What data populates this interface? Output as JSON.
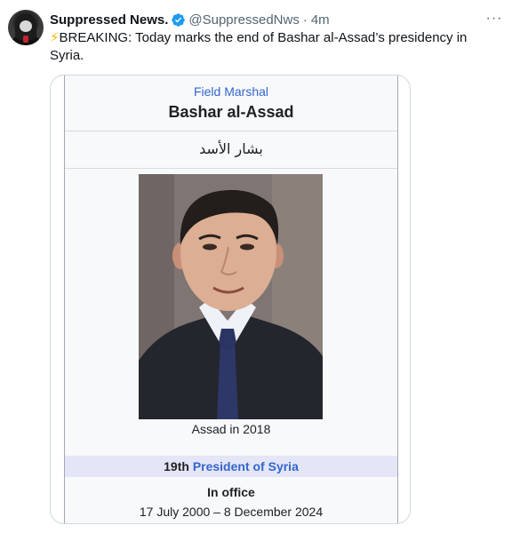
{
  "tweet": {
    "display_name": "Suppressed News.",
    "verified_icon": "verified-badge-icon",
    "handle": "@SuppressedNws",
    "separator": "·",
    "time": "4m",
    "more_icon": "more-options-icon",
    "more_glyph": "···",
    "bolt": "⚡",
    "text": "BREAKING: Today marks the end of Bashar al-Assad’s presidency in Syria."
  },
  "infobox": {
    "rank": "Field Marshal",
    "name": "Bashar al-Assad",
    "arabic_name": "بشار الأسد",
    "caption": "Assad in 2018",
    "office_ordinal": "19th",
    "office_title": "President of Syria",
    "in_office_label": "In office",
    "term": "17 July 2000 – 8 December 2024"
  },
  "colors": {
    "link": "#3366cc",
    "verified": "#1d9bf0",
    "muted": "#536471",
    "office_header_bg": "#e4e6f7"
  }
}
